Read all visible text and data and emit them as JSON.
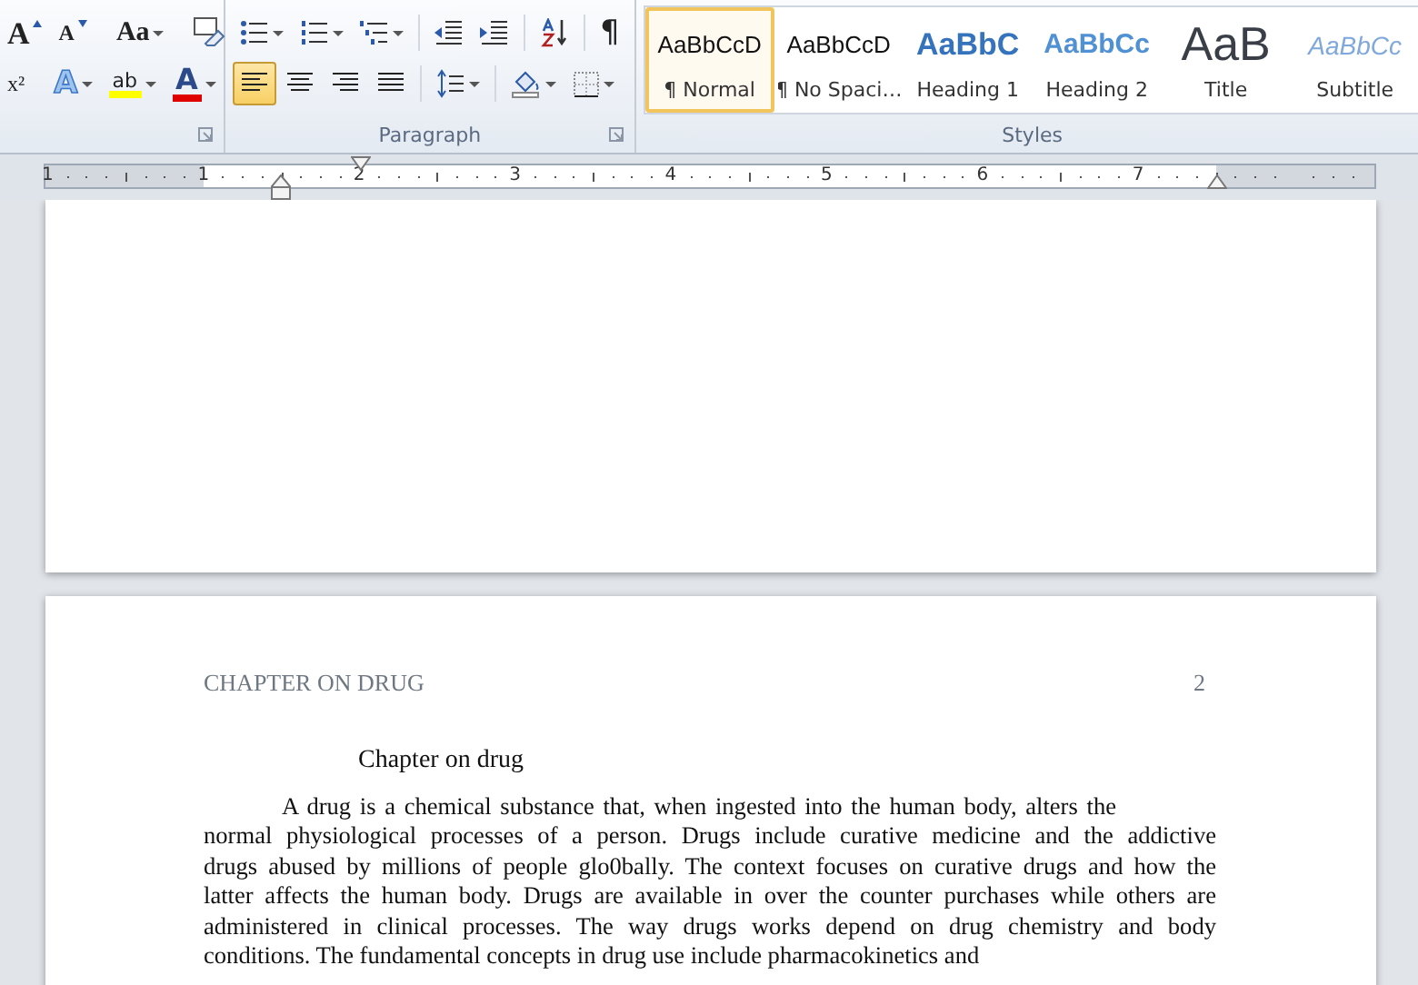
{
  "ribbon": {
    "font_rows": [
      [
        {
          "kind": "grow",
          "glyph": "A"
        },
        {
          "kind": "shrink",
          "glyph": "A"
        },
        {
          "kind": "sep"
        },
        {
          "kind": "case",
          "glyph": "Aa"
        },
        {
          "kind": "sep"
        },
        {
          "kind": "clear"
        }
      ],
      [
        {
          "kind": "superscript",
          "glyph": "x²"
        },
        {
          "kind": "sep"
        },
        {
          "kind": "effects",
          "glyph": "A"
        },
        {
          "kind": "highlight",
          "glyph": "ab"
        },
        {
          "kind": "color",
          "glyph": "A"
        }
      ]
    ],
    "paragraph_rows": [
      [
        {
          "kind": "bullets",
          "selected": false
        },
        {
          "kind": "numbering",
          "selected": false
        },
        {
          "kind": "multilevel",
          "selected": false
        },
        {
          "kind": "sep"
        },
        {
          "kind": "outdent",
          "selected": false
        },
        {
          "kind": "indent",
          "selected": false
        },
        {
          "kind": "sep"
        },
        {
          "kind": "sort",
          "selected": false
        },
        {
          "kind": "sep"
        },
        {
          "kind": "pilcrow",
          "glyph": "¶",
          "selected": false
        }
      ],
      [
        {
          "kind": "align-left",
          "selected": true
        },
        {
          "kind": "align-center",
          "selected": false
        },
        {
          "kind": "align-right",
          "selected": false
        },
        {
          "kind": "justify",
          "selected": false
        },
        {
          "kind": "sep"
        },
        {
          "kind": "spacing",
          "selected": false
        },
        {
          "kind": "sep"
        },
        {
          "kind": "shading",
          "selected": false
        },
        {
          "kind": "borders",
          "selected": false
        }
      ]
    ],
    "paragraph_label": "Paragraph",
    "styles": [
      {
        "kind": "normal",
        "preview": "AaBbCcD",
        "label": "¶ Normal",
        "selected": true
      },
      {
        "kind": "normal",
        "preview": "AaBbCcD",
        "label": "¶ No Spaci…",
        "selected": false
      },
      {
        "kind": "heading1",
        "preview": "AaBbC",
        "label": "Heading 1",
        "selected": false
      },
      {
        "kind": "heading2",
        "preview": "AaBbCc",
        "label": "Heading 2",
        "selected": false
      },
      {
        "kind": "title",
        "preview": "AaB",
        "label": "Title",
        "selected": false
      },
      {
        "kind": "subtitle",
        "preview": "AaBbCc",
        "label": "Subtitle",
        "selected": false
      }
    ],
    "styles_label": "Styles"
  },
  "ruler": {
    "numbers": [
      "1",
      "1",
      "2",
      "3",
      "4",
      "5",
      "6",
      "7"
    ]
  },
  "document": {
    "header": "CHAPTER ON DRUG",
    "page_number": "2",
    "title": "Chapter on drug",
    "paragraph_lines": [
      "A drug is a chemical substance  that, when ingested into the human body, alters the",
      "normal physiological  processes  of a person. Drugs include curative medicine and the addictive",
      "drugs abused  by millions of people glo0bally. The context focuses on curative drugs and how the",
      "latter affects the human body. Drugs are available  in over the counter purchases  while others are",
      "administered  in clinical processes.  The way drugs works depend on drug chemistry and body",
      "conditions.  The  fundamental  concepts  in drug use include pharmacokinetics  and"
    ]
  }
}
